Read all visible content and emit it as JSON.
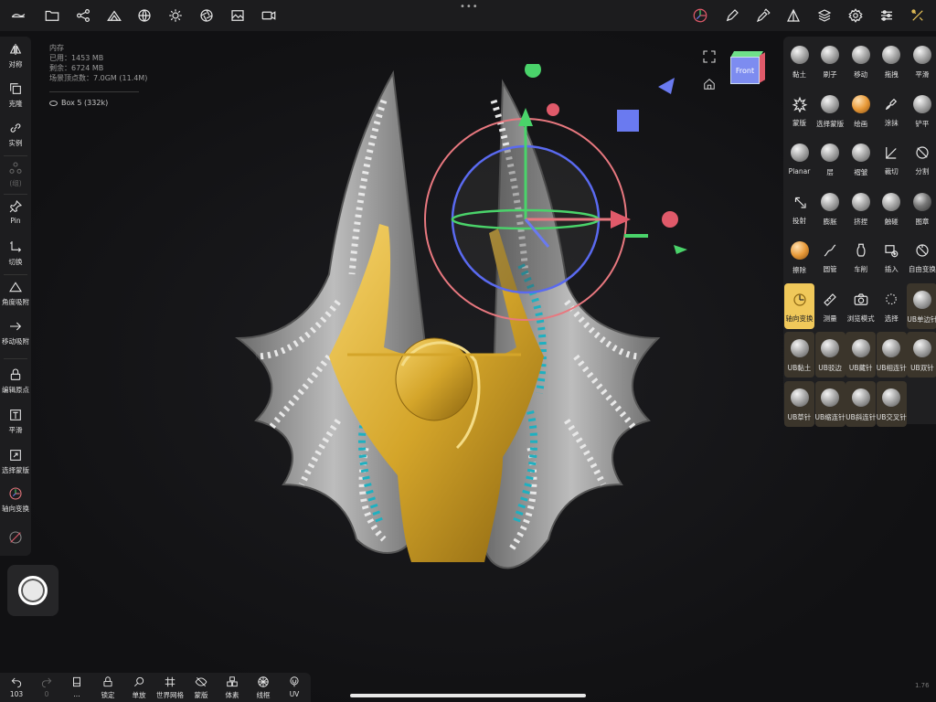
{
  "top_bar": {
    "left_icons": [
      "menu-logo-icon",
      "folder-icon",
      "share-nodes-icon",
      "scene-icon",
      "globe-icon",
      "sun-icon",
      "aperture-icon",
      "image-icon",
      "video-icon"
    ],
    "right_icons": [
      "gizmo-icon",
      "pencil-icon",
      "eyedropper-icon",
      "topology-icon",
      "layers-icon",
      "gear-icon",
      "sliders-icon",
      "tools-icon"
    ]
  },
  "info": {
    "heading": "内存",
    "used": "已用：1453 MB",
    "free": "剩余：6724 MB",
    "vertices": "场景顶点数：7.0GM (11.4M)",
    "object": "Box 5 (332k)"
  },
  "left_panel": {
    "items": [
      {
        "label": "对称",
        "icon": "symmetry-icon"
      },
      {
        "label": "克隆",
        "icon": "clone-icon"
      },
      {
        "label": "实例",
        "icon": "link-icon"
      },
      {
        "label": "(组)",
        "icon": "group-icon",
        "dim": true
      },
      {
        "label": "Pin",
        "icon": "pin-icon"
      },
      {
        "label": "切换",
        "icon": "switch-icon"
      },
      {
        "label": "角度吸附",
        "icon": "angle-snap-icon"
      },
      {
        "label": "移动吸附",
        "icon": "move-snap-icon"
      },
      {
        "label": "编辑原点",
        "icon": "lock-icon"
      },
      {
        "label": "平滑",
        "icon": "smooth-icon"
      },
      {
        "label": "选择蒙版",
        "icon": "select-mask-icon"
      },
      {
        "label": "轴向变换",
        "icon": "axis-transform-icon"
      }
    ]
  },
  "bottom_bar": {
    "items": [
      {
        "label": "103",
        "icon": "undo-icon"
      },
      {
        "label": "0",
        "icon": "redo-icon",
        "dim": true
      },
      {
        "label": "...",
        "icon": "book-icon"
      },
      {
        "label": "锁定",
        "icon": "lock-icon"
      },
      {
        "label": "单放",
        "icon": "magnifier-icon"
      },
      {
        "label": "世界网格",
        "icon": "grid-icon"
      },
      {
        "label": "蒙版",
        "icon": "eye-slash-icon"
      },
      {
        "label": "体素",
        "icon": "voxel-icon"
      },
      {
        "label": "线框",
        "icon": "wireframe-icon"
      },
      {
        "label": "UV",
        "icon": "uv-icon"
      }
    ]
  },
  "right_panel": {
    "rows": [
      [
        {
          "label": "黏土"
        },
        {
          "label": "刷子"
        },
        {
          "label": "移动"
        },
        {
          "label": "拖拽"
        },
        {
          "label": "平滑"
        }
      ],
      [
        {
          "label": "蒙版",
          "icon": "mask-splat-icon"
        },
        {
          "label": "选择蒙版"
        },
        {
          "label": "绘画",
          "orange": true
        },
        {
          "label": "涂抹",
          "icon": "smudge-icon"
        },
        {
          "label": "铲平"
        }
      ],
      [
        {
          "label": "Planar"
        },
        {
          "label": "层"
        },
        {
          "label": "褶皱"
        },
        {
          "label": "裁切",
          "icon": "trim-icon"
        },
        {
          "label": "分割",
          "icon": "split-icon"
        }
      ],
      [
        {
          "label": "投射",
          "icon": "project-icon"
        },
        {
          "label": "膨胀"
        },
        {
          "label": "挤捏"
        },
        {
          "label": "触碰"
        },
        {
          "label": "图章",
          "dark": true
        }
      ],
      [
        {
          "label": "擦除",
          "orange": true
        },
        {
          "label": "圆管",
          "icon": "tube-icon"
        },
        {
          "label": "车削",
          "icon": "lathe-icon"
        },
        {
          "label": "插入",
          "icon": "insert-icon"
        },
        {
          "label": "自由变换",
          "icon": "free-transform-icon"
        }
      ],
      [
        {
          "label": "轴向变换",
          "active": true,
          "icon": "axis-transform-icon"
        },
        {
          "label": "测量",
          "icon": "ruler-icon"
        },
        {
          "label": "浏览模式",
          "icon": "camera-icon"
        },
        {
          "label": "选择",
          "icon": "lasso-icon"
        },
        {
          "label": "UB单边针",
          "ub": true
        }
      ],
      [
        {
          "label": "UB黏土",
          "ub": true
        },
        {
          "label": "UB驳边",
          "ub": true
        },
        {
          "label": "UB藏针",
          "ub": true
        },
        {
          "label": "UB相连针",
          "ub": true
        },
        {
          "label": "UB双针",
          "ub": true
        }
      ],
      [
        {
          "label": "UB草针",
          "ub": true
        },
        {
          "label": "UB缩连针",
          "ub": true
        },
        {
          "label": "UB斜连针",
          "ub": true
        },
        {
          "label": "UB交叉针",
          "ub": true
        }
      ]
    ]
  },
  "nav_cube": {
    "face": "Front"
  },
  "version": "1.76",
  "colors": {
    "accent": "#f0c85a",
    "gold": "#d4a52a",
    "silver": "#9a9a9a",
    "teal": "#1fb0c0",
    "panel": "#1f1f21"
  }
}
